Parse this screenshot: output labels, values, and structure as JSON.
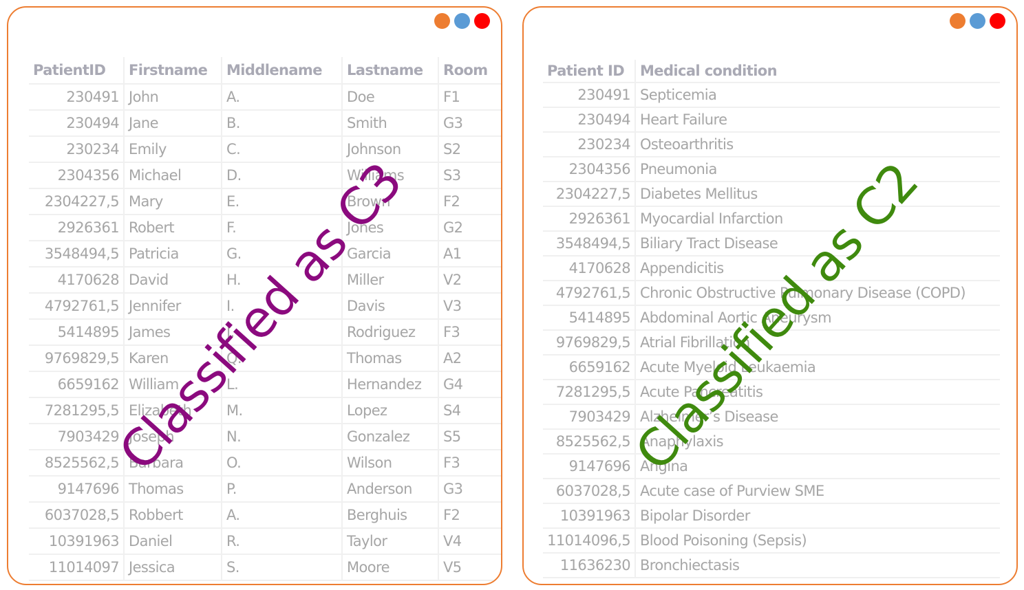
{
  "colors": {
    "border": "#ED7D31",
    "dot_orange": "#ED7D31",
    "dot_blue": "#5B9BD5",
    "dot_red": "#FF0000",
    "stamp_c3": "#8B0A7E",
    "stamp_c2": "#3F8A0E",
    "table_text": "#A6A6A6"
  },
  "window_controls": [
    {
      "name": "minimize-dot",
      "color": "orange"
    },
    {
      "name": "maximize-dot",
      "color": "blue"
    },
    {
      "name": "close-dot",
      "color": "red"
    }
  ],
  "left_panel": {
    "stamp": "Classified as C3",
    "columns": [
      "PatientID",
      "Firstname",
      "Middlename",
      "Lastname",
      "Room"
    ],
    "rows": [
      [
        "230491",
        "John",
        "A.",
        "Doe",
        "F1"
      ],
      [
        "230494",
        "Jane",
        "B.",
        "Smith",
        "G3"
      ],
      [
        "230234",
        "Emily",
        "C.",
        "Johnson",
        "S2"
      ],
      [
        "2304356",
        "Michael",
        "D.",
        "Williams",
        "S3"
      ],
      [
        "2304227,5",
        "Mary",
        "E.",
        "Brown",
        "F2"
      ],
      [
        "2926361",
        "Robert",
        "F.",
        "Jones",
        "G2"
      ],
      [
        "3548494,5",
        "Patricia",
        "G.",
        "Garcia",
        "A1"
      ],
      [
        "4170628",
        "David",
        "H.",
        "Miller",
        "V2"
      ],
      [
        "4792761,5",
        "Jennifer",
        "I.",
        "Davis",
        "V3"
      ],
      [
        "5414895",
        "James",
        "J.",
        "Rodriguez",
        "F3"
      ],
      [
        "9769829,5",
        "Karen",
        "Q.",
        "Thomas",
        "A2"
      ],
      [
        "6659162",
        "William",
        "L.",
        "Hernandez",
        "G4"
      ],
      [
        "7281295,5",
        "Elizabeth",
        "M.",
        "Lopez",
        "S4"
      ],
      [
        "7903429",
        "Joseph",
        "N.",
        "Gonzalez",
        "S5"
      ],
      [
        "8525562,5",
        "Barbara",
        "O.",
        "Wilson",
        "F3"
      ],
      [
        "9147696",
        "Thomas",
        "P.",
        "Anderson",
        "G3"
      ],
      [
        "6037028,5",
        "Robbert",
        "A.",
        "Berghuis",
        "F2"
      ],
      [
        "10391963",
        "Daniel",
        "R.",
        "Taylor",
        "V4"
      ],
      [
        "11014097",
        "Jessica",
        "S.",
        "Moore",
        "V5"
      ]
    ]
  },
  "right_panel": {
    "stamp": "Classified as C2",
    "columns": [
      "Patient ID",
      "Medical condition"
    ],
    "rows": [
      [
        "230491",
        "Septicemia"
      ],
      [
        "230494",
        "Heart Failure"
      ],
      [
        "230234",
        "Osteoarthritis"
      ],
      [
        "2304356",
        "Pneumonia"
      ],
      [
        "2304227,5",
        "Diabetes Mellitus"
      ],
      [
        "2926361",
        "Myocardial Infarction"
      ],
      [
        "3548494,5",
        "Biliary Tract Disease"
      ],
      [
        "4170628",
        "Appendicitis"
      ],
      [
        "4792761,5",
        "Chronic Obstructive Pulmonary Disease (COPD)"
      ],
      [
        "5414895",
        "Abdominal Aortic Aneurysm"
      ],
      [
        "9769829,5",
        "Atrial Fibrillation"
      ],
      [
        "6659162",
        "Acute Myeloid Leukaemia"
      ],
      [
        "7281295,5",
        "Acute Pancreatitis"
      ],
      [
        "7903429",
        "Alzheimer’s Disease"
      ],
      [
        "8525562,5",
        "Anaphylaxis"
      ],
      [
        "9147696",
        "Angina"
      ],
      [
        "6037028,5",
        "Acute case of Purview SME"
      ],
      [
        "10391963",
        "Bipolar Disorder"
      ],
      [
        "11014096,5",
        "Blood Poisoning (Sepsis)"
      ],
      [
        "11636230",
        "Bronchiectasis"
      ]
    ]
  }
}
